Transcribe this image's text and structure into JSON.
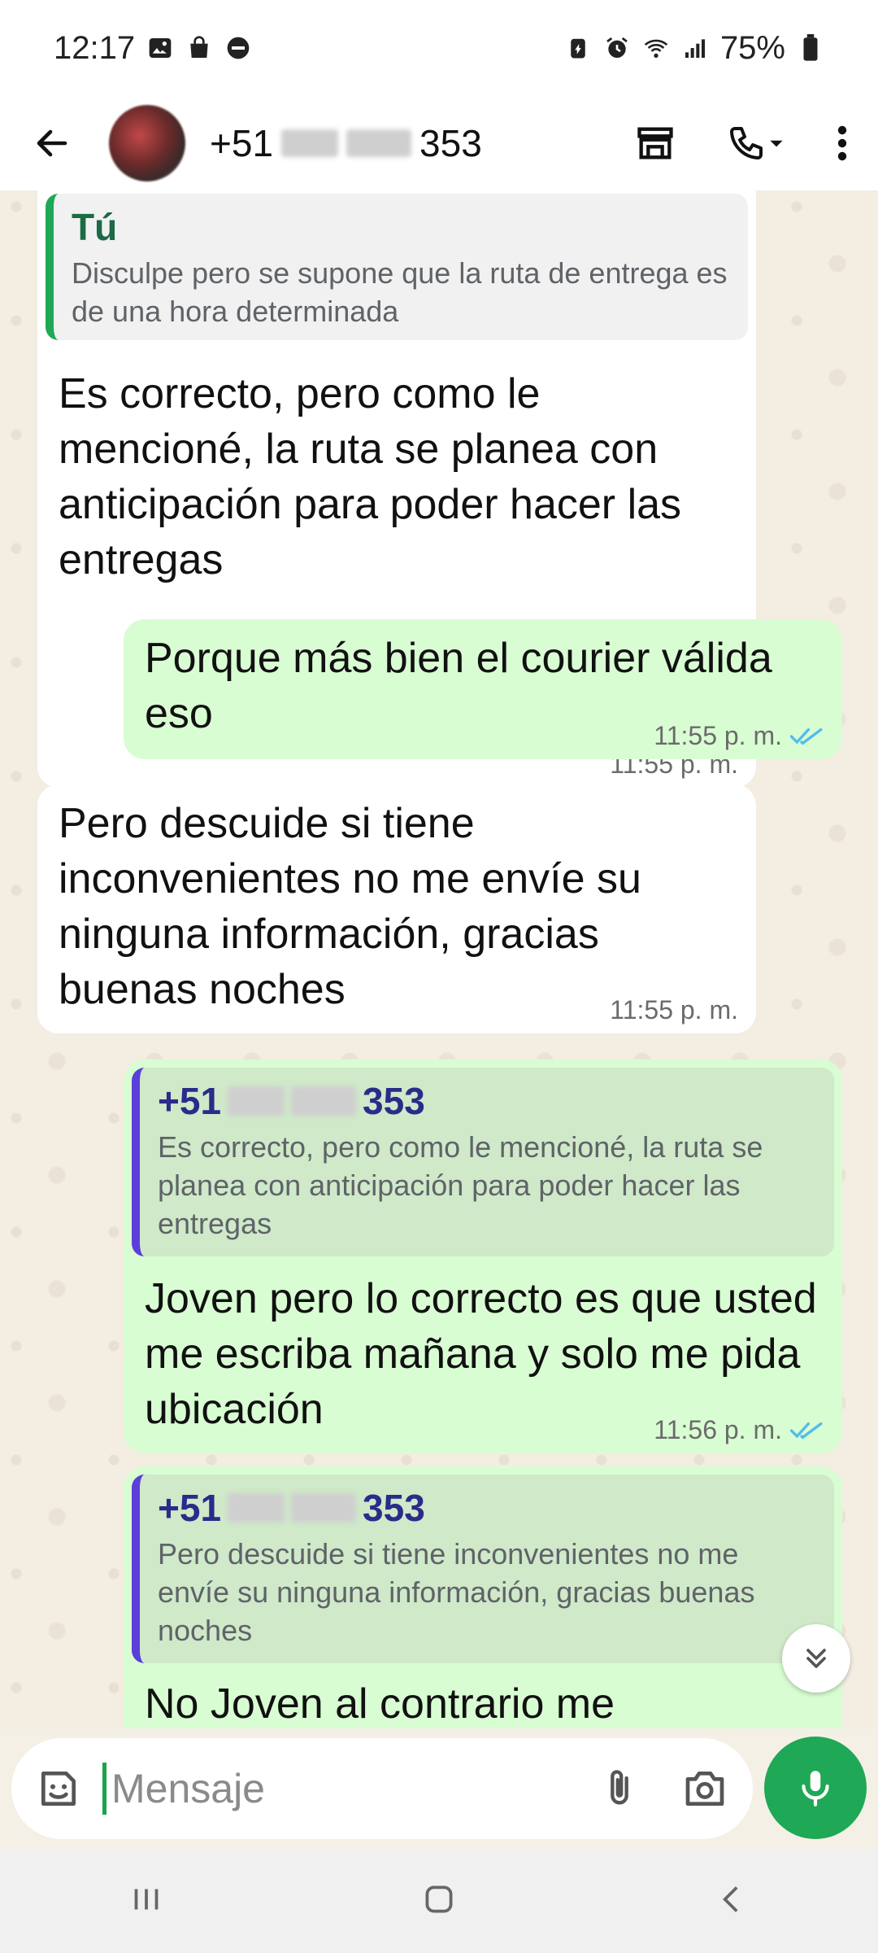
{
  "status_bar": {
    "time": "12:17",
    "battery": "75%"
  },
  "header": {
    "country_code": "+51",
    "phone_suffix": "353",
    "back_label": "Back",
    "menu_label": "More options"
  },
  "messages": [
    {
      "direction": "in",
      "quote": {
        "author": "Tú",
        "text": "Disculpe pero se supone que la ruta de entrega es de una hora determinada"
      },
      "text": "Es correcto, pero como le mencioné, la ruta se planea con anticipación para poder hacer las entregas",
      "time": "11:55 p. m."
    },
    {
      "direction": "out",
      "text": "Porque más bien el courier válida eso",
      "time": "11:55 p. m.",
      "read": true
    },
    {
      "direction": "in",
      "text": "Pero descuide si tiene inconvenientes no me envíe su ninguna información, gracias buenas noches",
      "time": "11:55 p. m."
    },
    {
      "direction": "out",
      "quote": {
        "author_prefix": "+51",
        "author_suffix": "353",
        "text": "Es correcto, pero como le mencioné, la ruta se planea con anticipación para poder hacer las entregas"
      },
      "text": "Joven pero lo correcto es que usted me escriba mañana y solo me pida ubicación",
      "time": "11:56 p. m.",
      "read": true
    },
    {
      "direction": "out",
      "quote": {
        "author_prefix": "+51",
        "author_suffix": "353",
        "text": "Pero descuide si tiene inconvenientes no me envíe su ninguna información, gracias buenas noches"
      },
      "text": "No Joven al contrario me"
    }
  ],
  "composer": {
    "placeholder": "Mensaje"
  },
  "colors": {
    "incoming_bubble": "#ffffff",
    "outgoing_bubble": "#d9fdd3",
    "accent_green": "#1fa855",
    "read_ticks": "#53bdeb",
    "quote_bar_self": "#1fa855",
    "quote_bar_other": "#5b3fd9"
  }
}
